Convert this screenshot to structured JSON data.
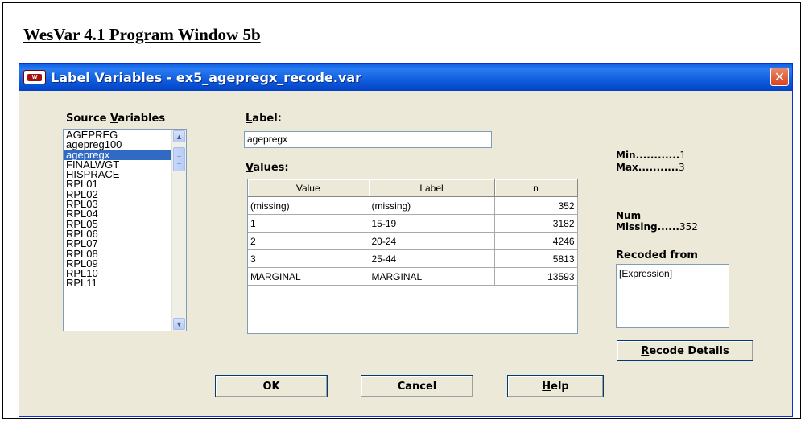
{
  "document_title": "WesVar 4.1 Program Window 5b",
  "window": {
    "title": "Label Variables - ex5_agepregx_recode.var",
    "icon": "wesvar-app-icon",
    "close_label": "×"
  },
  "source_variables": {
    "label": "Source Variables",
    "items": [
      "AGEPREG",
      "agepreg100",
      "agepregx",
      "FINALWGT",
      "HISPRACE",
      "RPL01",
      "RPL02",
      "RPL03",
      "RPL04",
      "RPL05",
      "RPL06",
      "RPL07",
      "RPL08",
      "RPL09",
      "RPL10",
      "RPL11"
    ],
    "selected": "agepregx"
  },
  "label_field": {
    "label": "Label:",
    "value": "agepregx"
  },
  "values_grid": {
    "label": "Values:",
    "columns": [
      "Value",
      "Label",
      "n"
    ],
    "rows": [
      [
        "(missing)",
        "(missing)",
        "352"
      ],
      [
        "1",
        "15-19",
        "3182"
      ],
      [
        "2",
        "20-24",
        "4246"
      ],
      [
        "3",
        "25-44",
        "5813"
      ],
      [
        "MARGINAL",
        "MARGINAL",
        "13593"
      ]
    ]
  },
  "stats": {
    "min_label": "Min",
    "min_value": "1",
    "max_label": "Max",
    "max_value": "3",
    "num_label": "Num",
    "missing_label": "Missing",
    "missing_value": "352"
  },
  "recoded_from": {
    "label": "Recoded from",
    "value": "[Expression]"
  },
  "buttons": {
    "recode_details": "Recode Details",
    "ok": "OK",
    "cancel": "Cancel",
    "help": "Help"
  }
}
